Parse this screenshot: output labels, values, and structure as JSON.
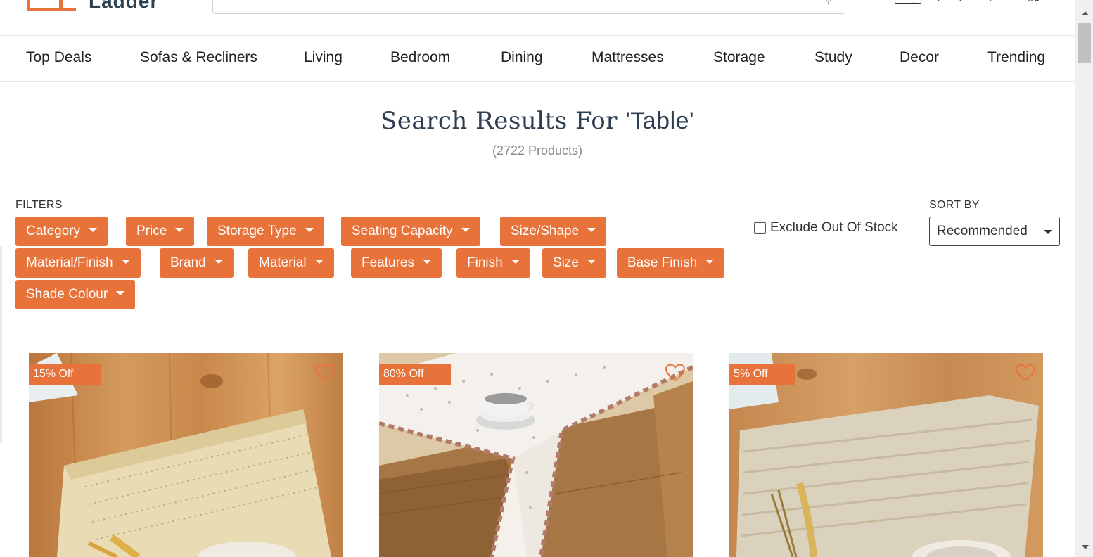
{
  "header": {
    "logo_text": "Ladder",
    "search_placeholder": ""
  },
  "nav": {
    "items": [
      "Top Deals",
      "Sofas & Recliners",
      "Living",
      "Bedroom",
      "Dining",
      "Mattresses",
      "Storage",
      "Study",
      "Decor",
      "Trending"
    ]
  },
  "results": {
    "title_prefix": "Search Results For ",
    "query": "'Table'",
    "count": "(2722 Products)"
  },
  "filters": {
    "label": "FILTERS",
    "chips": [
      "Category",
      "Price",
      "Storage Type",
      "Seating Capacity",
      "Size/Shape",
      "Material/Finish",
      "Brand",
      "Material",
      "Features",
      "Finish",
      "Size",
      "Base Finish",
      "Shade Colour"
    ],
    "exclude_out_of_stock": {
      "label": "Exclude Out Of Stock",
      "checked": false
    }
  },
  "sort": {
    "label": "SORT BY",
    "selected": "Recommended"
  },
  "products": [
    {
      "badge": "15% Off",
      "image": "placemat-icon"
    },
    {
      "badge": "80% Off",
      "image": "table-runner-icon"
    },
    {
      "badge": "5% Off",
      "image": "placemat-icon"
    }
  ],
  "colors": {
    "accent": "#e8733a",
    "brand_text": "#2c4253",
    "title": "#2c3e50"
  }
}
